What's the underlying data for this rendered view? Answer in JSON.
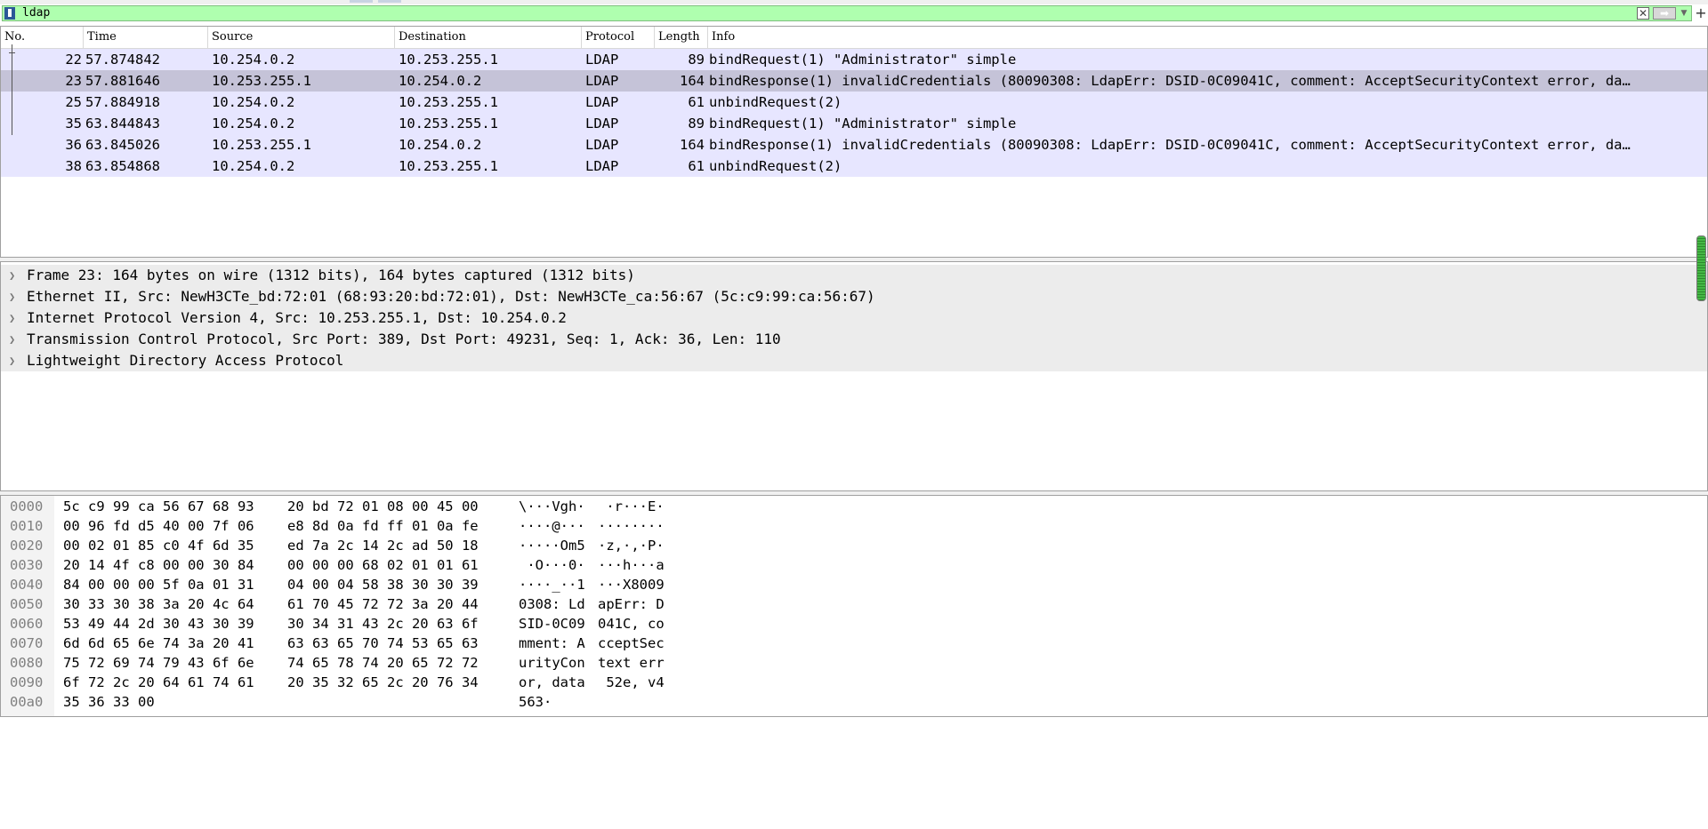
{
  "filter": {
    "value": "ldap"
  },
  "packet_list": {
    "columns": [
      "No.",
      "Time",
      "Source",
      "Destination",
      "Protocol",
      "Length",
      "Info"
    ],
    "rows": [
      {
        "no": "22",
        "time": "57.874842",
        "src": "10.254.0.2",
        "dst": "10.253.255.1",
        "proto": "LDAP",
        "len": "89",
        "info": "bindRequest(1) \"Administrator\" simple"
      },
      {
        "no": "23",
        "time": "57.881646",
        "src": "10.253.255.1",
        "dst": "10.254.0.2",
        "proto": "LDAP",
        "len": "164",
        "info": "bindResponse(1) invalidCredentials (80090308: LdapErr: DSID-0C09041C, comment: AcceptSecurityContext error, da…"
      },
      {
        "no": "25",
        "time": "57.884918",
        "src": "10.254.0.2",
        "dst": "10.253.255.1",
        "proto": "LDAP",
        "len": "61",
        "info": "unbindRequest(2)"
      },
      {
        "no": "35",
        "time": "63.844843",
        "src": "10.254.0.2",
        "dst": "10.253.255.1",
        "proto": "LDAP",
        "len": "89",
        "info": "bindRequest(1) \"Administrator\" simple"
      },
      {
        "no": "36",
        "time": "63.845026",
        "src": "10.253.255.1",
        "dst": "10.254.0.2",
        "proto": "LDAP",
        "len": "164",
        "info": "bindResponse(1) invalidCredentials (80090308: LdapErr: DSID-0C09041C, comment: AcceptSecurityContext error, da…"
      },
      {
        "no": "38",
        "time": "63.854868",
        "src": "10.254.0.2",
        "dst": "10.253.255.1",
        "proto": "LDAP",
        "len": "61",
        "info": "unbindRequest(2)"
      }
    ]
  },
  "details": {
    "items": [
      "Frame 23: 164 bytes on wire (1312 bits), 164 bytes captured (1312 bits)",
      "Ethernet II, Src: NewH3CTe_bd:72:01 (68:93:20:bd:72:01), Dst: NewH3CTe_ca:56:67 (5c:c9:99:ca:56:67)",
      "Internet Protocol Version 4, Src: 10.253.255.1, Dst: 10.254.0.2",
      "Transmission Control Protocol, Src Port: 389, Dst Port: 49231, Seq: 1, Ack: 36, Len: 110",
      "Lightweight Directory Access Protocol"
    ]
  },
  "bytes": {
    "lines": [
      {
        "off": "0000",
        "hex1": "5c c9 99 ca 56 67 68 93",
        "hex2": "20 bd 72 01 08 00 45 00",
        "asc1": "\\···Vgh·",
        "asc2": " ·r···E·"
      },
      {
        "off": "0010",
        "hex1": "00 96 fd d5 40 00 7f 06",
        "hex2": "e8 8d 0a fd ff 01 0a fe",
        "asc1": "····@···",
        "asc2": "········"
      },
      {
        "off": "0020",
        "hex1": "00 02 01 85 c0 4f 6d 35",
        "hex2": "ed 7a 2c 14 2c ad 50 18",
        "asc1": "·····Om5",
        "asc2": "·z,·,·P·"
      },
      {
        "off": "0030",
        "hex1": "20 14 4f c8 00 00 30 84",
        "hex2": "00 00 00 68 02 01 01 61",
        "asc1": " ·O···0·",
        "asc2": "···h···a"
      },
      {
        "off": "0040",
        "hex1": "84 00 00 00 5f 0a 01 31",
        "hex2": "04 00 04 58 38 30 30 39",
        "asc1": "····_··1",
        "asc2": "···X8009"
      },
      {
        "off": "0050",
        "hex1": "30 33 30 38 3a 20 4c 64",
        "hex2": "61 70 45 72 72 3a 20 44",
        "asc1": "0308: Ld",
        "asc2": "apErr: D"
      },
      {
        "off": "0060",
        "hex1": "53 49 44 2d 30 43 30 39",
        "hex2": "30 34 31 43 2c 20 63 6f",
        "asc1": "SID-0C09",
        "asc2": "041C, co"
      },
      {
        "off": "0070",
        "hex1": "6d 6d 65 6e 74 3a 20 41",
        "hex2": "63 63 65 70 74 53 65 63",
        "asc1": "mment: A",
        "asc2": "cceptSec"
      },
      {
        "off": "0080",
        "hex1": "75 72 69 74 79 43 6f 6e",
        "hex2": "74 65 78 74 20 65 72 72",
        "asc1": "urityCon",
        "asc2": "text err"
      },
      {
        "off": "0090",
        "hex1": "6f 72 2c 20 64 61 74 61",
        "hex2": "20 35 32 65 2c 20 76 34",
        "asc1": "or, data",
        "asc2": " 52e, v4"
      },
      {
        "off": "00a0",
        "hex1": "35 36 33 00",
        "hex2": "",
        "asc1": "563·",
        "asc2": ""
      }
    ]
  },
  "icons": {
    "bookmark": "bookmark-icon",
    "clear": "clear-icon",
    "apply": "apply-arrow-icon",
    "add": "plus-icon",
    "expand": "chevron-right-icon"
  },
  "colors": {
    "filter_valid": "#afffaf",
    "row_bg": "#e7e6ff",
    "row_selected": "#c5c3d8",
    "tree_bg": "#ececec"
  }
}
